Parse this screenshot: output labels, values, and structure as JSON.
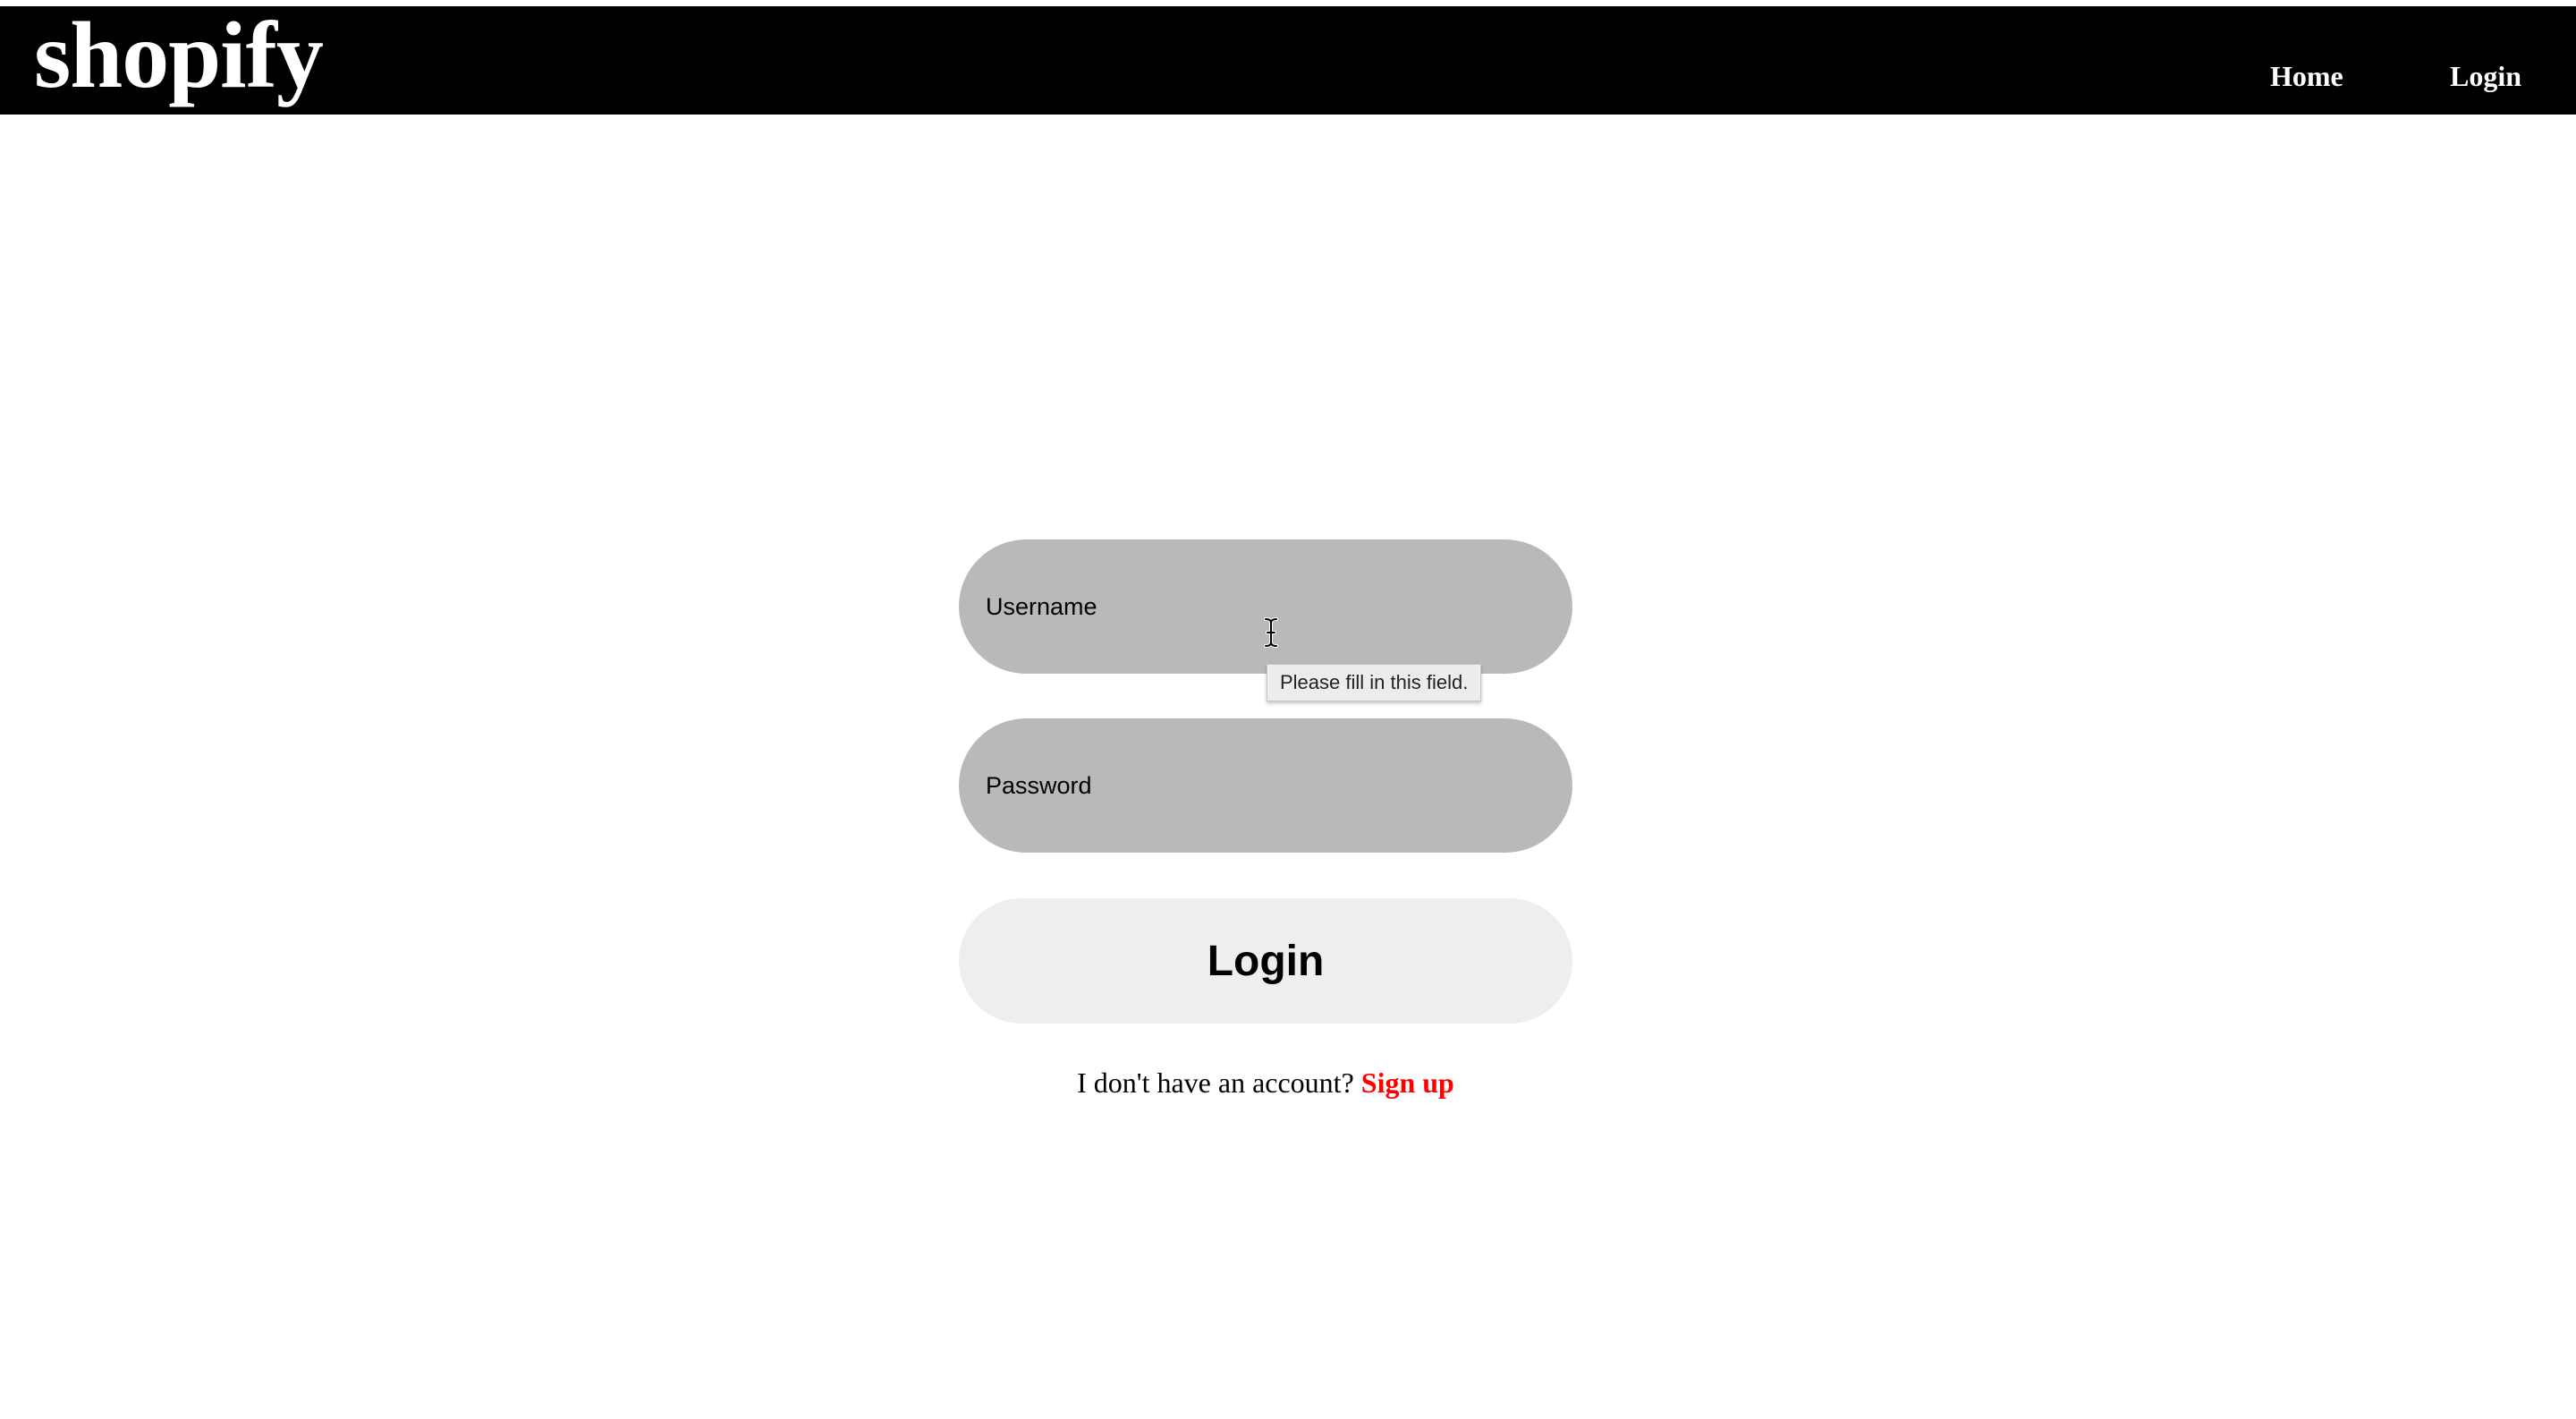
{
  "header": {
    "brand": "shopify",
    "nav": {
      "home_label": "Home",
      "login_label": "Login"
    }
  },
  "login_form": {
    "username": {
      "placeholder": "Username",
      "value": ""
    },
    "password": {
      "placeholder": "Password",
      "value": ""
    },
    "submit_label": "Login",
    "signup_prompt": "I don't have an account?",
    "signup_link_label": "Sign up",
    "validation_tooltip": "Please fill in this field."
  },
  "colors": {
    "header_bg": "#000000",
    "header_text": "#ffffff",
    "input_bg": "#bab9b7",
    "button_bg": "#eeeeee",
    "signup_link": "#ff0000"
  },
  "icons": {
    "cursor": "text-cursor-icon"
  }
}
